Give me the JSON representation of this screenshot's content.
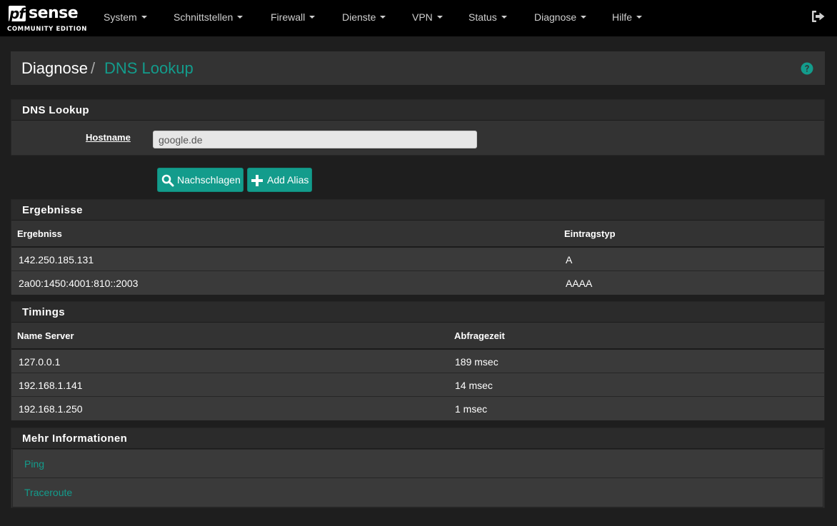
{
  "brand": {
    "pf": "pf",
    "sense": "sense",
    "edition": "COMMUNITY EDITION"
  },
  "nav": {
    "items": [
      {
        "label": "System"
      },
      {
        "label": "Schnittstellen"
      },
      {
        "label": "Firewall"
      },
      {
        "label": "Dienste"
      },
      {
        "label": "VPN"
      },
      {
        "label": "Status"
      },
      {
        "label": "Diagnose"
      },
      {
        "label": "Hilfe"
      }
    ],
    "logout_icon": "sign-out-icon"
  },
  "breadcrumb": {
    "parent": "Diagnose",
    "separator": "/",
    "current": "DNS Lookup",
    "help_icon": "question-circle-icon"
  },
  "lookup_panel": {
    "title": "DNS Lookup",
    "hostname_label": "Hostname",
    "hostname_value": "google.de"
  },
  "buttons": {
    "lookup_label": "Nachschlagen",
    "lookup_icon": "search-icon",
    "add_alias_label": "Add Alias",
    "add_alias_icon": "plus-icon"
  },
  "results_panel": {
    "title": "Ergebnisse",
    "columns": [
      "Ergebniss",
      "Eintragstyp"
    ],
    "rows": [
      [
        "142.250.185.131",
        "A"
      ],
      [
        "2a00:1450:4001:810::2003",
        "AAAA"
      ]
    ]
  },
  "timings_panel": {
    "title": "Timings",
    "columns": [
      "Name Server",
      "Abfragezeit"
    ],
    "rows": [
      [
        "127.0.0.1",
        "189 msec"
      ],
      [
        "192.168.1.141",
        "14 msec"
      ],
      [
        "192.168.1.250",
        "1 msec"
      ]
    ]
  },
  "more_panel": {
    "title": "Mehr Informationen",
    "links": [
      "Ping",
      "Traceroute"
    ]
  },
  "colors": {
    "accent": "#139c8c",
    "navbar": "#000000",
    "panel": "#333333",
    "background": "#1e1e1e"
  }
}
